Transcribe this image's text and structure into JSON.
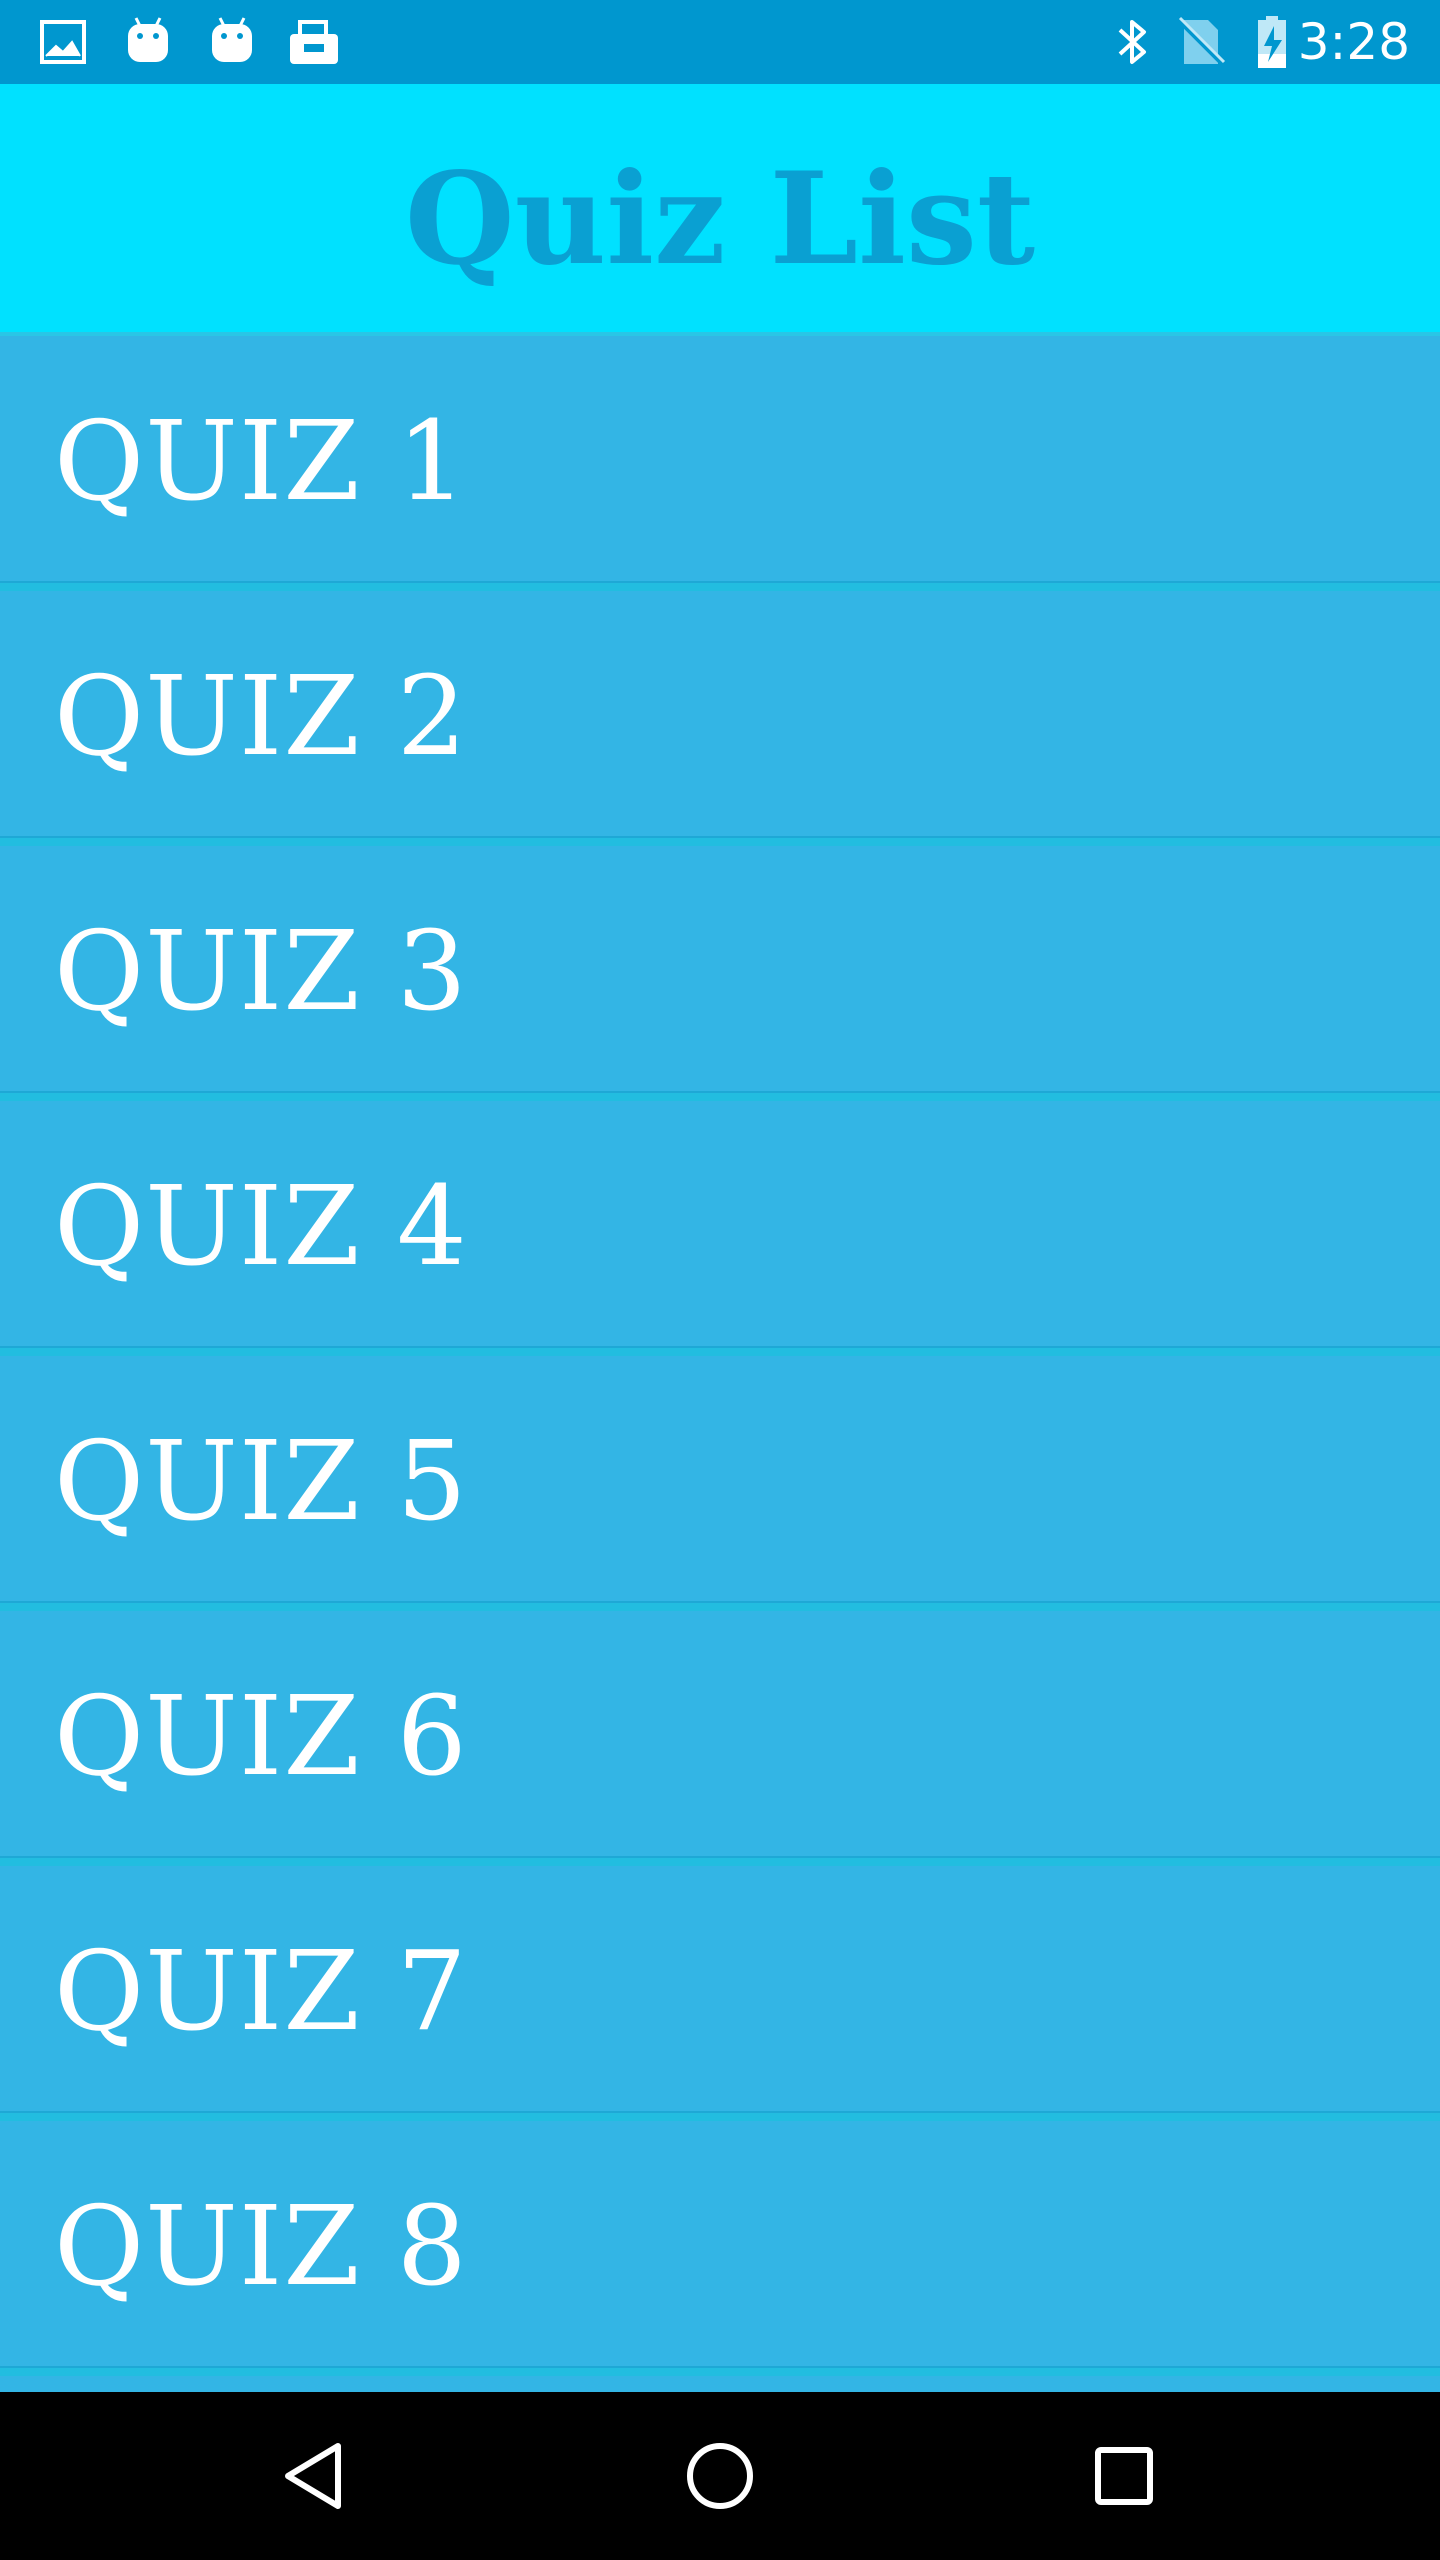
{
  "status_bar": {
    "time": "3:28",
    "left_icons": [
      "image-icon",
      "android-icon",
      "android-icon",
      "briefcase-icon"
    ],
    "right_icons": [
      "bluetooth-icon",
      "no-sim-icon",
      "battery-charging-icon"
    ]
  },
  "header": {
    "title": "Quiz List"
  },
  "quiz_list": {
    "items": [
      {
        "label": "QUIZ 1"
      },
      {
        "label": "QUIZ 2"
      },
      {
        "label": "QUIZ 3"
      },
      {
        "label": "QUIZ 4"
      },
      {
        "label": "QUIZ 5"
      },
      {
        "label": "QUIZ 6"
      },
      {
        "label": "QUIZ 7"
      },
      {
        "label": "QUIZ 8"
      }
    ]
  },
  "nav_bar": {
    "buttons": [
      "back-icon",
      "home-icon",
      "recents-icon"
    ]
  },
  "colors": {
    "status_bar": "#0097cf",
    "header_bg": "#00e1ff",
    "title_text": "#0aa0d2",
    "list_item_bg": "#33b5e5",
    "list_item_text": "#ffffff",
    "nav_bar": "#000000"
  }
}
